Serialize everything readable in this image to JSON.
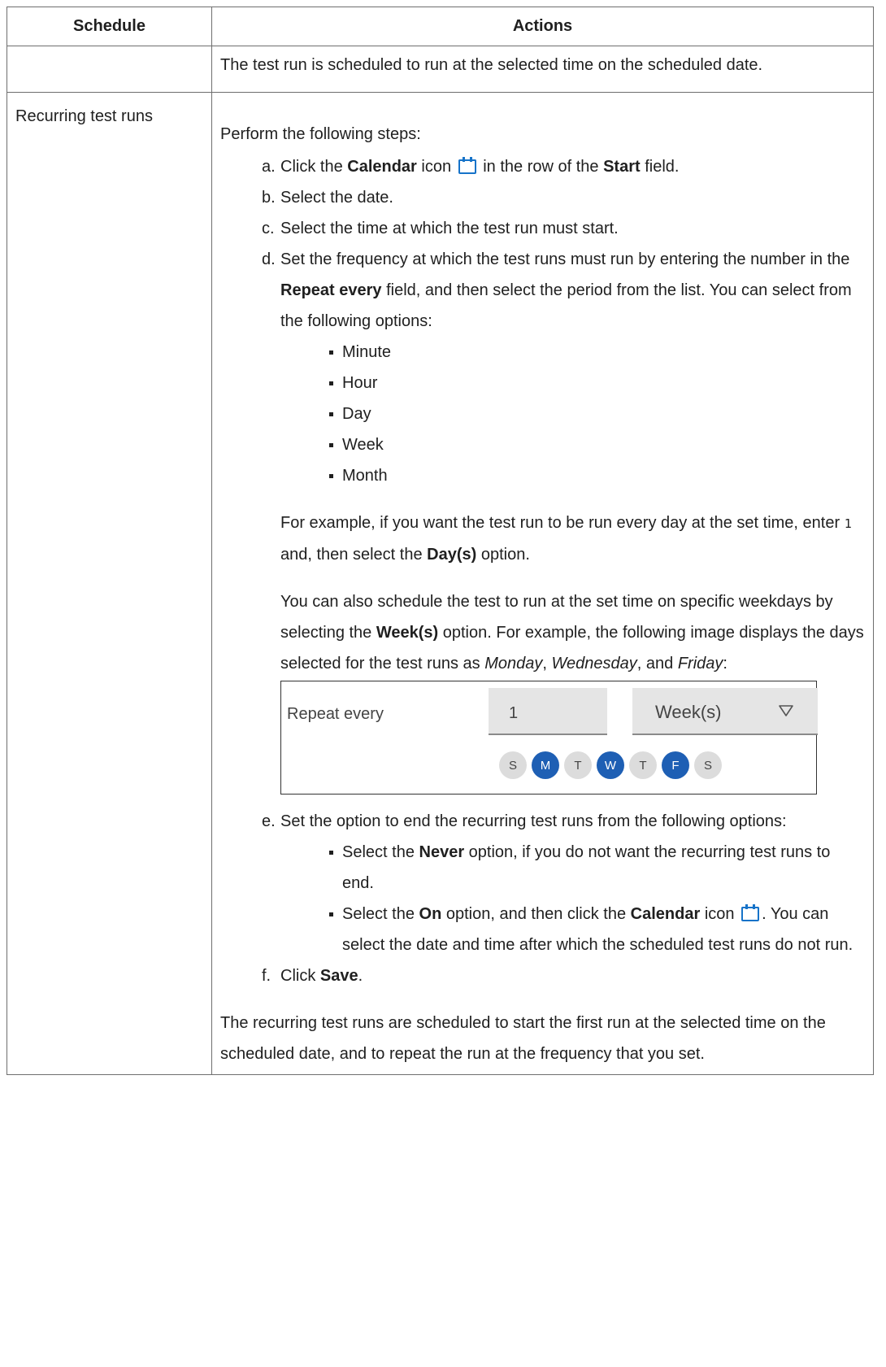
{
  "table": {
    "headers": [
      "Schedule",
      "Actions"
    ]
  },
  "row1": {
    "schedule": "",
    "text": "The test run is scheduled to run at the selected time on the scheduled date."
  },
  "row2": {
    "schedule": "Recurring test runs",
    "intro": "Perform the following steps:",
    "step_a": {
      "mark": "a.",
      "p1": "Click the ",
      "b1": "Calendar",
      "p2": " icon ",
      "p3": " in the row of the ",
      "b2": "Start",
      "p4": " field."
    },
    "step_b": {
      "mark": "b.",
      "text": "Select the date."
    },
    "step_c": {
      "mark": "c.",
      "text": "Select the time at which the test run must start."
    },
    "step_d": {
      "mark": "d.",
      "p1": "Set the frequency at which the test runs must run by entering the number in the ",
      "b1": "Repeat every",
      "p2": " field, and then select the period from the list. You can select from the following options:",
      "options": [
        "Minute",
        "Hour",
        "Day",
        "Week",
        "Month"
      ],
      "ex1_p1": "For example, if you want the test run to be run every day at the set time, enter ",
      "ex1_code": "1",
      "ex1_p2": " and, then select the ",
      "ex1_b": "Day(s)",
      "ex1_p3": " option.",
      "ex2_p1": "You can also schedule the test to run at the set time on specific weekdays by selecting the ",
      "ex2_b": "Week(s)",
      "ex2_p2": " option. For example, the following image displays the days selected for the test runs as ",
      "ex2_i1": "Monday",
      "ex2_p3": ", ",
      "ex2_i2": "Wednesday",
      "ex2_p4": ", and ",
      "ex2_i3": "Friday",
      "ex2_p5": ":"
    },
    "figure": {
      "label": "Repeat every",
      "number": "1",
      "period": "Week(s)",
      "days": [
        {
          "letter": "S",
          "selected": false
        },
        {
          "letter": "M",
          "selected": true
        },
        {
          "letter": "T",
          "selected": false
        },
        {
          "letter": "W",
          "selected": true
        },
        {
          "letter": "T",
          "selected": false
        },
        {
          "letter": "F",
          "selected": true
        },
        {
          "letter": "S",
          "selected": false
        }
      ],
      "selected_color": "#1e5fb4",
      "unselected_color": "#dcdcdc"
    },
    "step_e": {
      "mark": "e.",
      "text": "Set the option to end the recurring test runs from the following options:",
      "opt1_p1": "Select the ",
      "opt1_b": "Never",
      "opt1_p2": " option, if you do not want the recurring test runs to end.",
      "opt2_p1": "Select the ",
      "opt2_b1": "On",
      "opt2_p2": " option, and then click the ",
      "opt2_b2": "Calendar",
      "opt2_p3": " icon ",
      "opt2_p4": ". You can select the date and time after which the scheduled test runs do not run."
    },
    "step_f": {
      "mark": "f.",
      "p1": "Click ",
      "b1": "Save",
      "p2": "."
    },
    "outro": "The recurring test runs are scheduled to start the first run at the selected time on the scheduled date, and to repeat the run at the frequency that you set."
  },
  "icons": {
    "calendar": "calendar-icon",
    "dropdown": "triangle-down-icon"
  },
  "accent_color": "#1673c9"
}
